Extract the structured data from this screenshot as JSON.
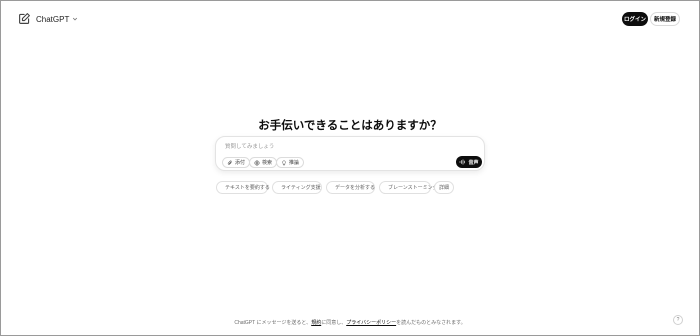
{
  "header": {
    "model_name": "ChatGPT",
    "login_label": "ログイン",
    "signup_label": "新規登録"
  },
  "main": {
    "headline": "お手伝いできることはありますか？"
  },
  "composer": {
    "placeholder": "質問してみましょう",
    "tools": [
      {
        "label": "添付",
        "icon": "paperclip-icon"
      },
      {
        "label": "検索",
        "icon": "globe-icon"
      },
      {
        "label": "推論",
        "icon": "lightbulb-icon"
      }
    ],
    "voice_label": "音声"
  },
  "suggestions": [
    {
      "label": "テキストを要約する",
      "icon": "document-icon",
      "color": "#e97a3d"
    },
    {
      "label": "ライティング支援",
      "icon": "pen-icon",
      "color": "#c66ad6"
    },
    {
      "label": "データを分析する",
      "icon": "chart-icon",
      "color": "#3fa9f5"
    },
    {
      "label": "ブレーンストーミング",
      "icon": "lightbulb-icon",
      "color": "#e6b93a"
    },
    {
      "label": "詳細"
    }
  ],
  "footer": {
    "prefix": "ChatGPT にメッセージを送ると、",
    "terms_label": "規約",
    "middle": "に同意し、",
    "privacy_label": "プライバシーポリシー",
    "suffix": "を読んだものとみなされます。",
    "help_label": "?"
  }
}
